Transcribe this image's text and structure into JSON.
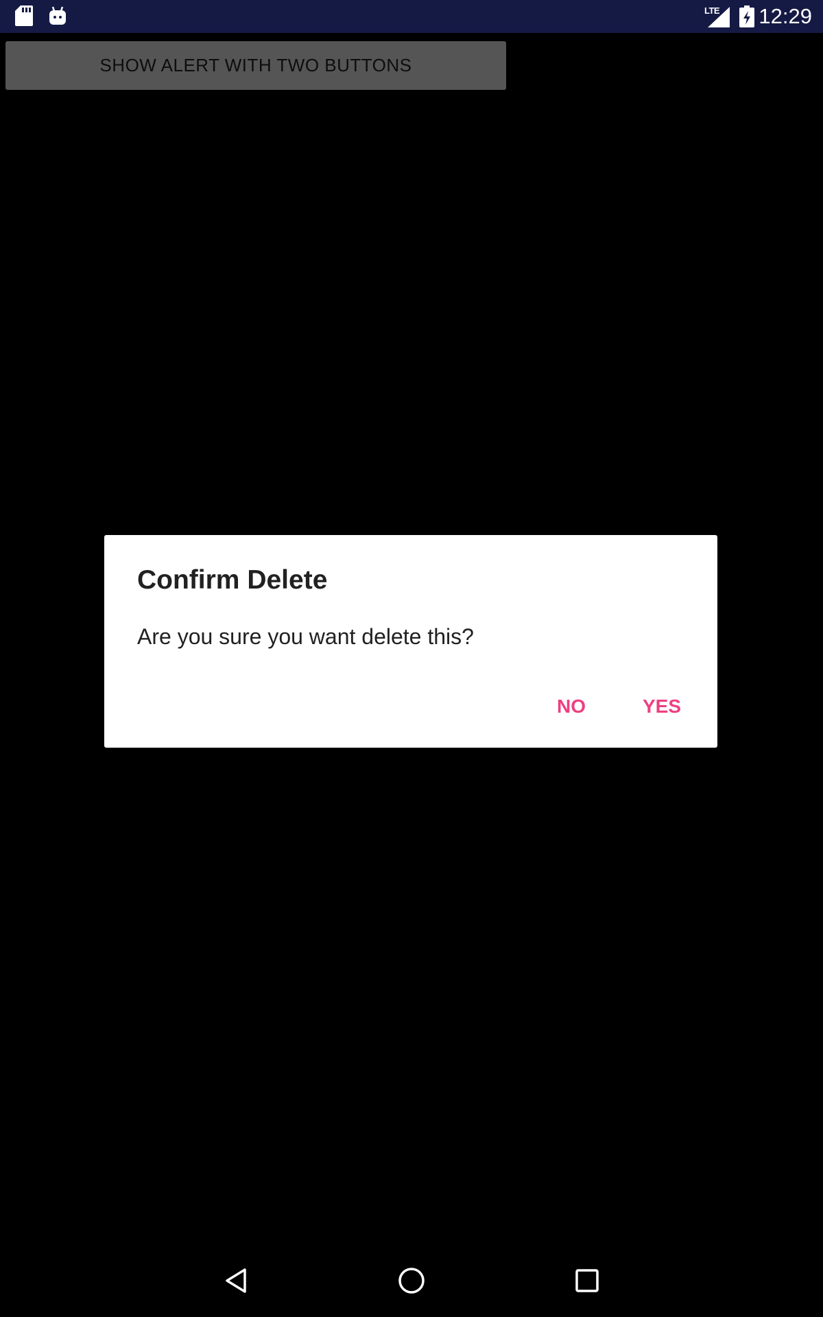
{
  "status_bar": {
    "time": "12:29",
    "network_label": "LTE",
    "icons": [
      "sd-card-icon",
      "android-icon",
      "signal-icon",
      "battery-charging-icon"
    ]
  },
  "main": {
    "show_alert_button_label": "SHOW ALERT WITH TWO BUTTONS"
  },
  "dialog": {
    "title": "Confirm Delete",
    "message": "Are you sure you want delete this?",
    "negative_label": "NO",
    "positive_label": "YES"
  },
  "nav_bar": {
    "buttons": [
      "back-icon",
      "home-icon",
      "recents-icon"
    ]
  },
  "colors": {
    "status_bar": "#151a45",
    "accent": "#ee3f82",
    "dialog_bg": "#ffffff",
    "button_bg": "#555555"
  }
}
